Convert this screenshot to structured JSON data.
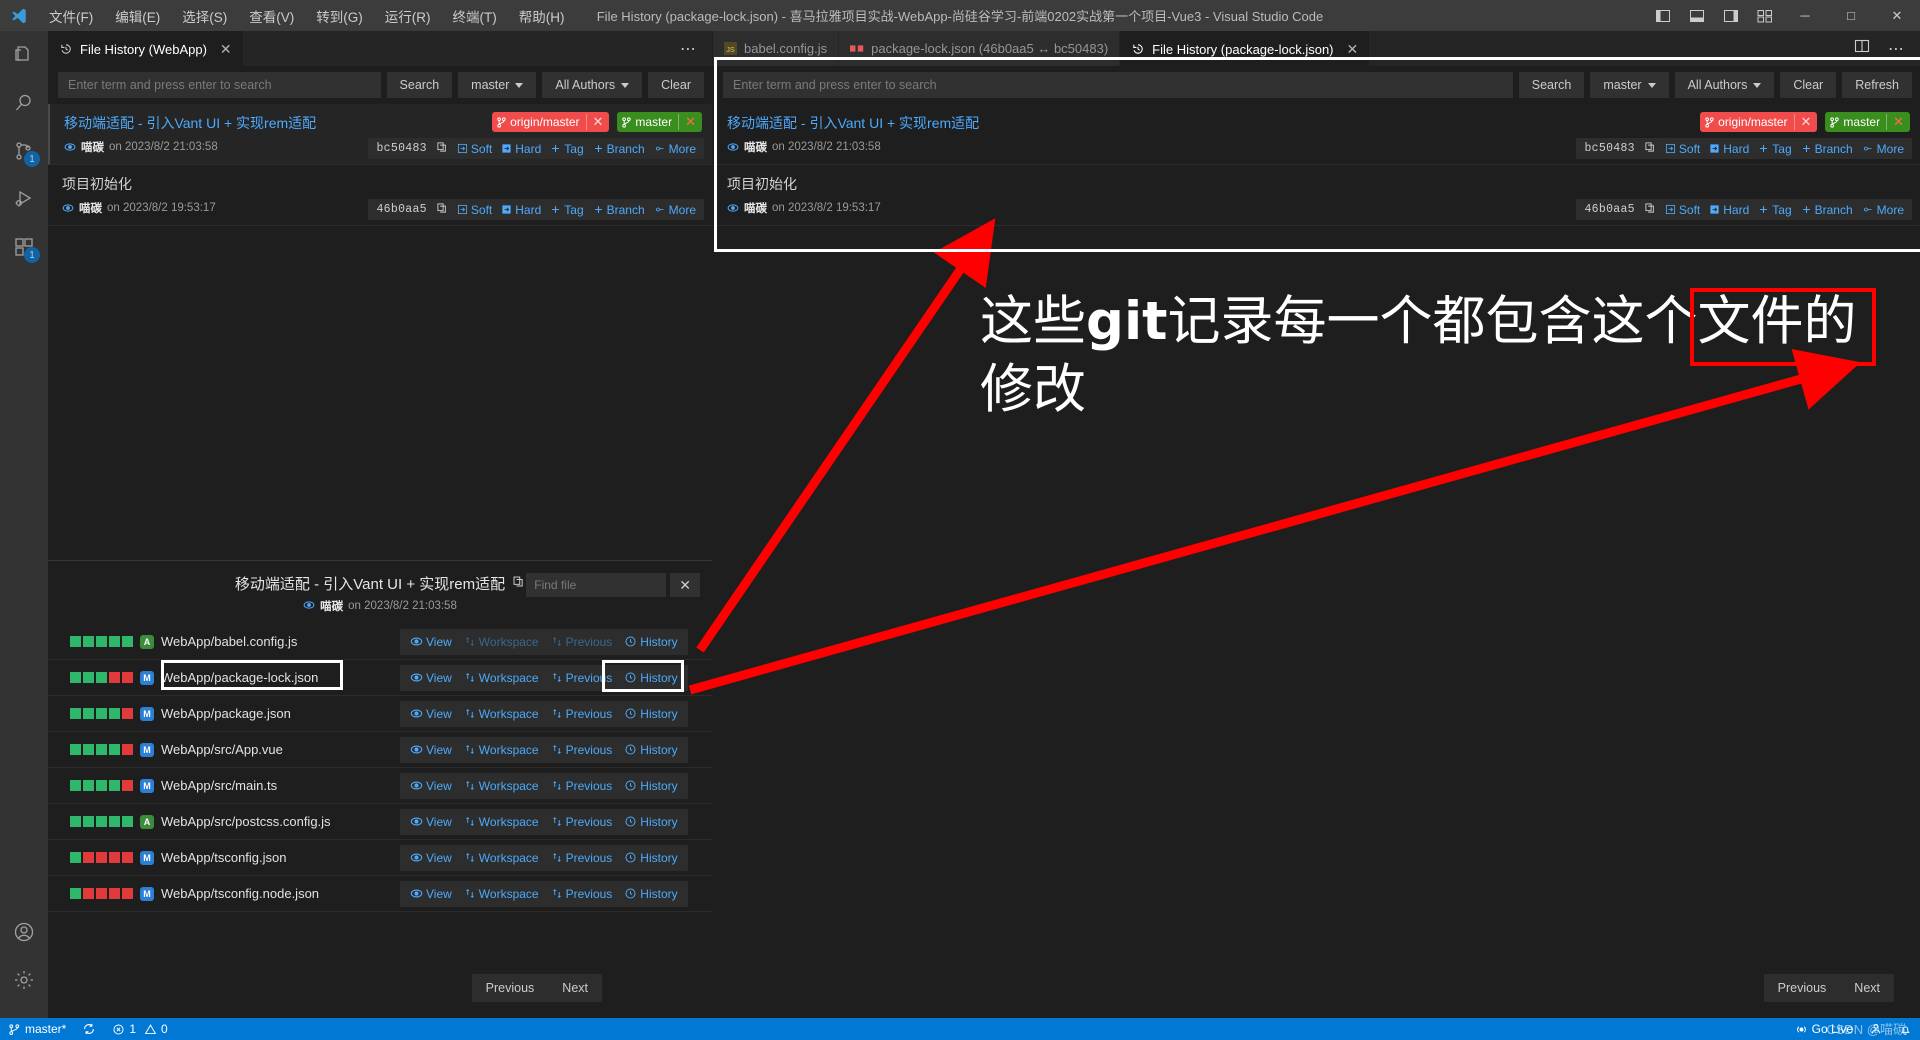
{
  "titlebar": {
    "menus": [
      "文件(F)",
      "编辑(E)",
      "选择(S)",
      "查看(V)",
      "转到(G)",
      "运行(R)",
      "终端(T)",
      "帮助(H)"
    ],
    "title": "File History (package-lock.json) - 喜马拉雅项目实战-WebApp-尚硅谷学习-前端0202实战第一个项目-Vue3 - Visual Studio Code",
    "window_controls": {
      "minimize": "─",
      "maximize": "□",
      "close": "✕"
    },
    "layout_icons": [
      "toggle-primary-sidebar",
      "toggle-panel",
      "toggle-secondary-sidebar",
      "customize-layout"
    ]
  },
  "activitybar": {
    "items": [
      {
        "name": "explorer",
        "icon": "files-icon",
        "badge": ""
      },
      {
        "name": "search",
        "icon": "search-icon",
        "badge": ""
      },
      {
        "name": "source-control",
        "icon": "source-control-icon",
        "badge": "1"
      },
      {
        "name": "run-and-debug",
        "icon": "debug-icon",
        "badge": ""
      },
      {
        "name": "extensions",
        "icon": "extensions-icon",
        "badge": "1"
      }
    ],
    "bottom": [
      {
        "name": "accounts",
        "icon": "account-icon"
      },
      {
        "name": "manage",
        "icon": "gear-icon"
      }
    ]
  },
  "left_group": {
    "tabs": [
      {
        "label": "File History (WebApp)",
        "icon": "history-icon",
        "active": true,
        "close": "✕"
      }
    ],
    "tab_overflow": "⋯",
    "search": {
      "placeholder": "Enter term and press enter to search",
      "value": "",
      "search_label": "Search",
      "branch_label": "master",
      "authors_label": "All Authors",
      "clear_label": "Clear"
    },
    "commits": [
      {
        "subject": "移动端适配 - 引入Vant UI + 实现rem适配",
        "author": "喵碳",
        "date": "on 2023/8/2 21:03:58",
        "hash": "bc50483",
        "selected": true,
        "refs": [
          {
            "type": "remote",
            "name": "origin/master",
            "close": "✕"
          },
          {
            "type": "local",
            "name": "master",
            "close": "✕"
          }
        ],
        "actions": [
          "Soft",
          "Hard",
          "Tag",
          "Branch",
          "More"
        ]
      },
      {
        "subject": "项目初始化",
        "author": "喵碳",
        "date": "on 2023/8/2 19:53:17",
        "hash": "46b0aa5",
        "selected": false,
        "refs": [],
        "actions": [
          "Soft",
          "Hard",
          "Tag",
          "Branch",
          "More"
        ]
      }
    ]
  },
  "right_group": {
    "tabs": [
      {
        "label": "babel.config.js",
        "icon": "js-icon",
        "active": false,
        "close": ""
      },
      {
        "label": "package-lock.json (46b0aa5 ↔ bc50483)",
        "icon": "json-diff-icon",
        "active": false,
        "close": ""
      },
      {
        "label": "File History (package-lock.json)",
        "icon": "history-icon",
        "active": true,
        "close": "✕"
      }
    ],
    "search": {
      "placeholder": "Enter term and press enter to search",
      "value": "",
      "search_label": "Search",
      "branch_label": "master",
      "authors_label": "All Authors",
      "clear_label": "Clear",
      "refresh_label": "Refresh"
    },
    "commits": [
      {
        "subject": "移动端适配 - 引入Vant UI + 实现rem适配",
        "author": "喵碳",
        "date": "on 2023/8/2 21:03:58",
        "hash": "bc50483",
        "selected": false,
        "refs": [
          {
            "type": "remote",
            "name": "origin/master",
            "close": "✕"
          },
          {
            "type": "local",
            "name": "master",
            "close": "✕"
          }
        ],
        "actions": [
          "Soft",
          "Hard",
          "Tag",
          "Branch",
          "More"
        ]
      },
      {
        "subject": "项目初始化",
        "author": "喵碳",
        "date": "on 2023/8/2 19:53:17",
        "hash": "46b0aa5",
        "selected": false,
        "refs": [],
        "actions": [
          "Soft",
          "Hard",
          "Tag",
          "Branch",
          "More"
        ]
      }
    ],
    "nav": {
      "previous": "Previous",
      "next": "Next"
    }
  },
  "file_panel": {
    "title": "移动端适配 - 引入Vant UI + 实现rem适配",
    "copy_icon": "copy-icon",
    "author": "喵碳",
    "date": "on 2023/8/2 21:03:58",
    "find": {
      "placeholder": "Find file",
      "value": "",
      "clear": "✕"
    },
    "row_actions": [
      "View",
      "Workspace",
      "Previous",
      "History"
    ],
    "files": [
      {
        "path": "WebApp/babel.config.js",
        "status": "A",
        "bars": [
          "g",
          "g",
          "g",
          "g",
          "g"
        ]
      },
      {
        "path": "WebApp/package-lock.json",
        "status": "M",
        "bars": [
          "g",
          "g",
          "g",
          "r",
          "r"
        ]
      },
      {
        "path": "WebApp/package.json",
        "status": "M",
        "bars": [
          "g",
          "g",
          "g",
          "g",
          "r"
        ]
      },
      {
        "path": "WebApp/src/App.vue",
        "status": "M",
        "bars": [
          "g",
          "g",
          "g",
          "g",
          "r"
        ]
      },
      {
        "path": "WebApp/src/main.ts",
        "status": "M",
        "bars": [
          "g",
          "g",
          "g",
          "g",
          "r"
        ]
      },
      {
        "path": "WebApp/src/postcss.config.js",
        "status": "A",
        "bars": [
          "g",
          "g",
          "g",
          "g",
          "g"
        ]
      },
      {
        "path": "WebApp/tsconfig.json",
        "status": "M",
        "bars": [
          "g",
          "r",
          "r",
          "r",
          "r"
        ]
      },
      {
        "path": "WebApp/tsconfig.node.json",
        "status": "M",
        "bars": [
          "g",
          "r",
          "r",
          "r",
          "r"
        ]
      }
    ],
    "nav": {
      "previous": "Previous",
      "next": "Next"
    }
  },
  "statusbar": {
    "branch": "master*",
    "sync_icon": "sync-icon",
    "errors": "1",
    "warnings": "0",
    "golive": "Go Live",
    "bell_icon": "bell-icon",
    "remote_icon": "remote-icon",
    "watermark": "CSDN @喵碳"
  },
  "annotation": {
    "line1_a": "这些",
    "line1_b": "git",
    "line1_c": "记录每一个都包含",
    "line1_d": "这个文件",
    "line1_e": "的",
    "line2": "修改",
    "box_color": "#ff0000",
    "arrow_color": "#ff0000"
  },
  "colors": {
    "accent": "#0078d4",
    "link": "#4daafc",
    "added": "#2fb86b",
    "deleted": "#e03a3a",
    "remote_ref": "#f14c4c",
    "local_ref": "#3a8e1e",
    "annotation": "#ff0000"
  }
}
